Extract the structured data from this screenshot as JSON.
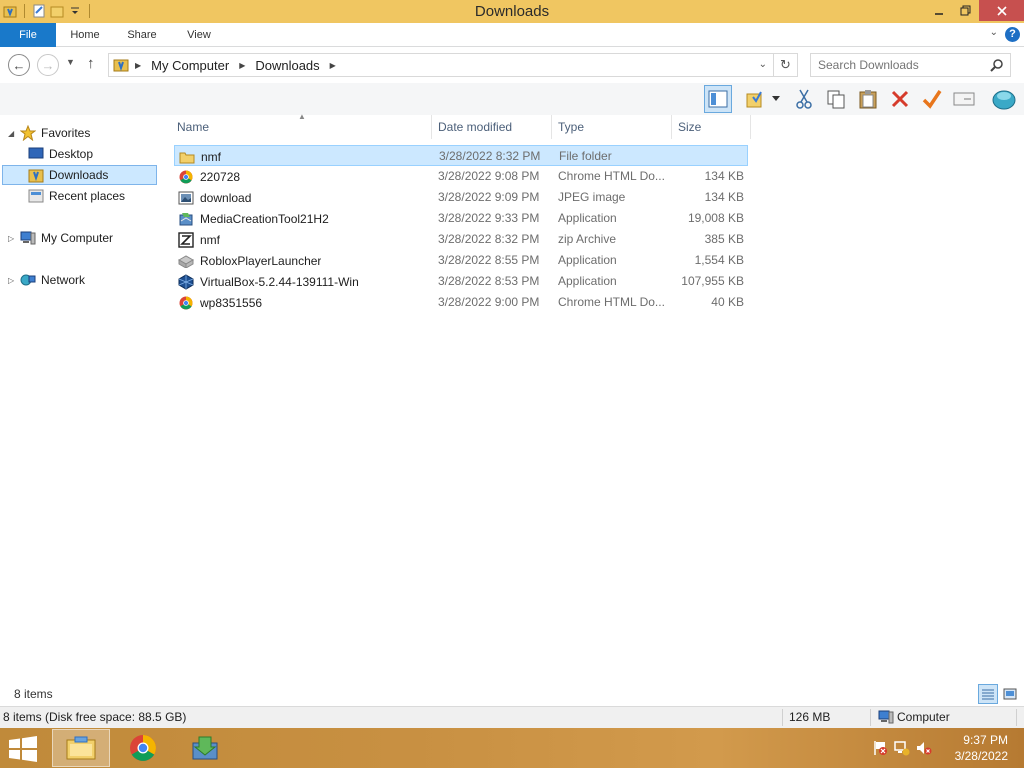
{
  "window": {
    "title": "Downloads"
  },
  "ribbon": {
    "tabs": [
      "File",
      "Home",
      "Share",
      "View"
    ],
    "help_label": "?"
  },
  "address": {
    "crumbs": [
      "My Computer",
      "Downloads"
    ]
  },
  "search": {
    "placeholder": "Search Downloads"
  },
  "nav": {
    "favorites_label": "Favorites",
    "desktop_label": "Desktop",
    "downloads_label": "Downloads",
    "recent_label": "Recent places",
    "computer_label": "My Computer",
    "network_label": "Network"
  },
  "columns": {
    "name": "Name",
    "date": "Date modified",
    "type": "Type",
    "size": "Size"
  },
  "files": [
    {
      "name": "nmf",
      "date": "3/28/2022 8:32 PM",
      "type": "File folder",
      "size": "",
      "icon": "folder-icon"
    },
    {
      "name": "220728",
      "date": "3/28/2022 9:08 PM",
      "type": "Chrome HTML Do...",
      "size": "134 KB",
      "icon": "chrome-icon"
    },
    {
      "name": "download",
      "date": "3/28/2022 9:09 PM",
      "type": "JPEG image",
      "size": "134 KB",
      "icon": "image-icon"
    },
    {
      "name": "MediaCreationTool21H2",
      "date": "3/28/2022 9:33 PM",
      "type": "Application",
      "size": "19,008 KB",
      "icon": "setup-icon"
    },
    {
      "name": "nmf",
      "date": "3/28/2022 8:32 PM",
      "type": "zip Archive",
      "size": "385 KB",
      "icon": "zip-icon"
    },
    {
      "name": "RobloxPlayerLauncher",
      "date": "3/28/2022 8:55 PM",
      "type": "Application",
      "size": "1,554 KB",
      "icon": "roblox-icon"
    },
    {
      "name": "VirtualBox-5.2.44-139111-Win",
      "date": "3/28/2022 8:53 PM",
      "type": "Application",
      "size": "107,955 KB",
      "icon": "virtualbox-icon"
    },
    {
      "name": "wp8351556",
      "date": "3/28/2022 9:00 PM",
      "type": "Chrome HTML Do...",
      "size": "40 KB",
      "icon": "chrome-icon"
    }
  ],
  "status": {
    "item_count": "8 items",
    "info_left": "8 items (Disk free space: 88.5 GB)",
    "info_size": "126 MB",
    "info_location": "Computer"
  },
  "taskbar": {
    "time": "9:37 PM",
    "date": "3/28/2022"
  },
  "colors": {
    "titlebar": "#f0c661",
    "file_tab": "#1979ca",
    "close_button": "#c7504f",
    "selection": "#cce8ff"
  }
}
